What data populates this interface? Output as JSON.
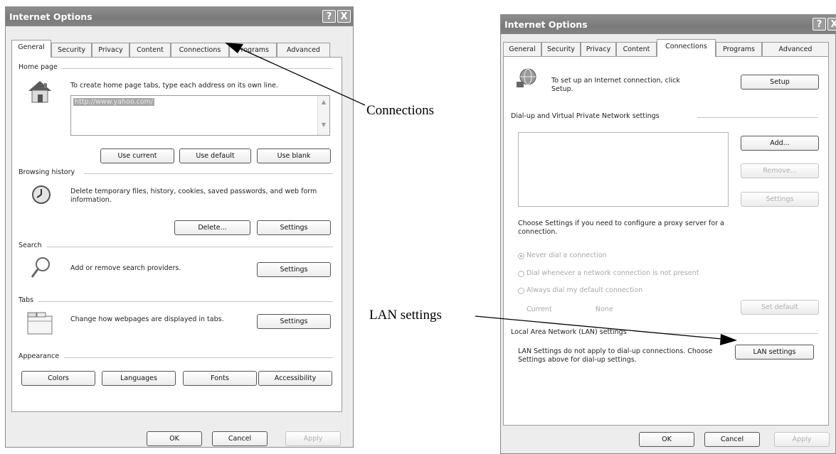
{
  "window_title": "Internet Options",
  "help_glyph": "?",
  "close_glyph": "X",
  "tabs": [
    "General",
    "Security",
    "Privacy",
    "Content",
    "Connections",
    "Programs",
    "Advanced"
  ],
  "general": {
    "home_page": {
      "legend": "Home page",
      "instructions": "To create home page tabs, type each address on its own line.",
      "url": "http://www.yahoo.com/",
      "buttons": [
        "Use current",
        "Use default",
        "Use blank"
      ]
    },
    "browsing_history": {
      "legend": "Browsing history",
      "text": "Delete temporary files, history, cookies, saved passwords, and web form information.",
      "buttons": [
        "Delete...",
        "Settings"
      ]
    },
    "search": {
      "legend": "Search",
      "text": "Add or remove search providers.",
      "button": "Settings"
    },
    "tabs": {
      "legend": "Tabs",
      "text": "Change how webpages are displayed in tabs.",
      "button": "Settings"
    },
    "appearance": {
      "legend": "Appearance",
      "buttons": [
        "Colors",
        "Languages",
        "Fonts",
        "Accessibility"
      ]
    }
  },
  "connections": {
    "setup_text": "To set up an Internet connection, click Setup.",
    "setup_button": "Setup",
    "dialup_legend": "Dial-up and Virtual Private Network settings",
    "dialup_buttons": [
      "Add...",
      "Remove...",
      "Settings"
    ],
    "proxy_text": "Choose Settings if you need to configure a proxy server for a connection.",
    "radio_options": [
      "Never dial a connection",
      "Dial whenever a network connection is not present",
      "Always dial my default connection"
    ],
    "current_label": "Current",
    "current_value": "None",
    "set_default_button": "Set default",
    "lan_legend": "Local Area Network (LAN) settings",
    "lan_text": "LAN Settings do not apply to dial-up connections. Choose Settings above for dial-up settings.",
    "lan_button": "LAN settings"
  },
  "footer_buttons": {
    "ok": "OK",
    "cancel": "Cancel",
    "apply": "Apply"
  },
  "callouts": {
    "connections": "Connections",
    "lan": "LAN settings"
  },
  "colors": {
    "titlebar": "#808080",
    "panel": "#ffffff",
    "window": "#ededed"
  }
}
